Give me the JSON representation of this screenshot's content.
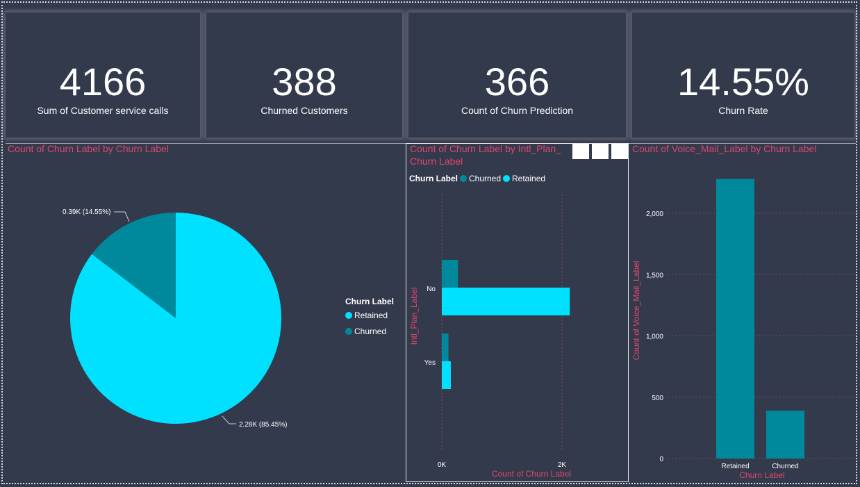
{
  "kpis": [
    {
      "value": "4166",
      "label": "Sum of Customer service calls"
    },
    {
      "value": "388",
      "label": "Churned Customers"
    },
    {
      "value": "366",
      "label": "Count of Churn Prediction"
    },
    {
      "value": "14.55%",
      "label": "Churn Rate"
    }
  ],
  "colors": {
    "retained": "#00e1ff",
    "churned": "#00899c",
    "title": "#e0466c",
    "background": "#333a4c"
  },
  "chart_data": [
    {
      "type": "pie",
      "title": "Count of Churn Label by Churn Label",
      "legend_title": "Churn Label",
      "legend_position": "right",
      "categories": [
        "Retained",
        "Churned"
      ],
      "values": [
        2280,
        390
      ],
      "data_labels": [
        "2.28K (85.45%)",
        "0.39K (14.55%)"
      ]
    },
    {
      "type": "bar",
      "orientation": "horizontal",
      "title": "Count of Churn Label by Intl_Plan_Label and Churn Label",
      "title_line1": "Count of Churn Label by Intl_Plan_",
      "title_line2": "Churn Label",
      "legend_title": "Churn Label",
      "legend_position": "top-left",
      "categories": [
        "No",
        "Yes"
      ],
      "series": [
        {
          "name": "Churned",
          "values": [
            270,
            110
          ]
        },
        {
          "name": "Retained",
          "values": [
            2130,
            150
          ]
        }
      ],
      "xlabel": "Count of Churn Label",
      "ylabel": "Intl_Plan_Label",
      "xlim": [
        0,
        2500
      ],
      "xticks": [
        "0K",
        "2K"
      ],
      "xtick_values": [
        0,
        2000
      ],
      "grid": true
    },
    {
      "type": "bar",
      "title": "Count of Voice_Mail_Label by Churn Label",
      "categories": [
        "Retained",
        "Churned"
      ],
      "values": [
        2280,
        390
      ],
      "xlabel": "Churn Label",
      "ylabel": "Count of Voice_Mail_Label",
      "ylim": [
        0,
        2300
      ],
      "yticks": [
        "0",
        "500",
        "1,000",
        "1,500",
        "2,000"
      ],
      "ytick_values": [
        0,
        500,
        1000,
        1500,
        2000
      ],
      "grid": true
    }
  ]
}
